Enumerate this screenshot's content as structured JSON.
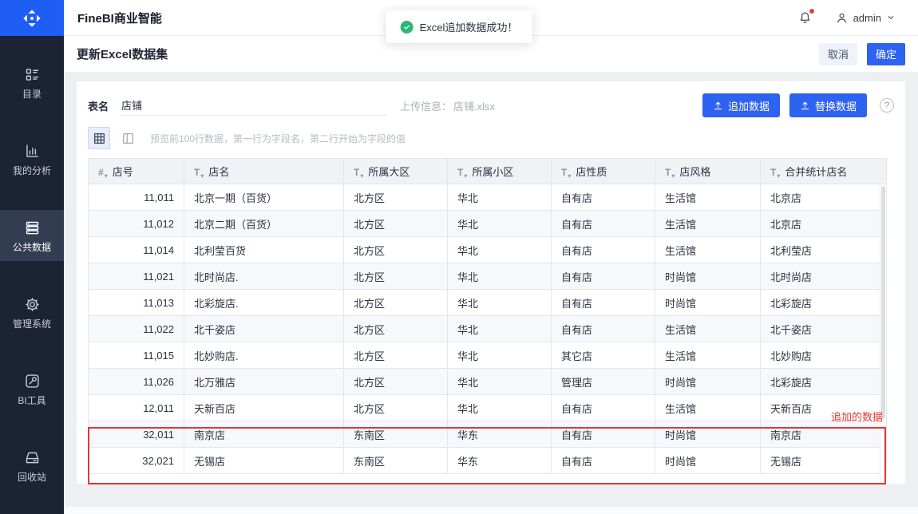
{
  "header": {
    "app_title": "FineBI商业智能",
    "user_name": "admin"
  },
  "toast": {
    "message": "Excel追加数据成功！"
  },
  "sidebar": {
    "logo_icon": "finebi-logo-icon",
    "items": [
      {
        "id": "directory",
        "label": "目录",
        "icon": "directory-icon",
        "active": false
      },
      {
        "id": "analysis",
        "label": "我的分析",
        "icon": "my-analysis-icon",
        "active": false
      },
      {
        "id": "public-data",
        "label": "公共数据",
        "icon": "public-data-icon",
        "active": true
      },
      {
        "id": "manage",
        "label": "管理系统",
        "icon": "gear-icon",
        "active": false
      },
      {
        "id": "tools",
        "label": "BI工具",
        "icon": "bi-tools-icon",
        "active": false
      },
      {
        "id": "recycle",
        "label": "回收站",
        "icon": "recycle-bin-icon",
        "active": false
      }
    ]
  },
  "page": {
    "title": "更新Excel数据集",
    "cancel_label": "取消",
    "confirm_label": "确定"
  },
  "form": {
    "table_name_label": "表名",
    "table_name_value": "店铺",
    "upload_info_label": "上传信息：",
    "upload_file_name": "店铺.xlsx",
    "append_button_label": "追加数据",
    "replace_button_label": "替换数据",
    "help_label": "?",
    "preview_hint": "预览前100行数据，第一行为字段名，第二行开始为字段的值"
  },
  "table": {
    "sort_glyph": "▾",
    "columns": [
      {
        "key": "store-no",
        "label": "店号",
        "type": "number",
        "type_icon": "#"
      },
      {
        "key": "store-name",
        "label": "店名",
        "type": "text",
        "type_icon": "T"
      },
      {
        "key": "region",
        "label": "所属大区",
        "type": "text",
        "type_icon": "T"
      },
      {
        "key": "district",
        "label": "所属小区",
        "type": "text",
        "type_icon": "T"
      },
      {
        "key": "store-type",
        "label": "店性质",
        "type": "text",
        "type_icon": "T"
      },
      {
        "key": "store-style",
        "label": "店风格",
        "type": "text",
        "type_icon": "T"
      },
      {
        "key": "merged-name",
        "label": "合并统计店名",
        "type": "text",
        "type_icon": "T"
      }
    ],
    "rows": [
      [
        "11,011",
        "北京一期（百货）",
        "北方区",
        "华北",
        "自有店",
        "生活馆",
        "北京店"
      ],
      [
        "11,012",
        "北京二期（百货）",
        "北方区",
        "华北",
        "自有店",
        "生活馆",
        "北京店"
      ],
      [
        "11,014",
        "北利莹百货",
        "北方区",
        "华北",
        "自有店",
        "生活馆",
        "北利莹店"
      ],
      [
        "11,021",
        "北时尚店.",
        "北方区",
        "华北",
        "自有店",
        "时尚馆",
        "北时尚店"
      ],
      [
        "11,013",
        "北彩旋店.",
        "北方区",
        "华北",
        "自有店",
        "时尚馆",
        "北彩旋店"
      ],
      [
        "11,022",
        "北千姿店",
        "北方区",
        "华北",
        "自有店",
        "生活馆",
        "北千姿店"
      ],
      [
        "11,015",
        "北妙购店.",
        "北方区",
        "华北",
        "其它店",
        "生活馆",
        "北妙购店"
      ],
      [
        "11,026",
        "北万雅店",
        "北方区",
        "华北",
        "管理店",
        "时尚馆",
        "北彩旋店"
      ],
      [
        "12,011",
        "天新百店",
        "北方区",
        "华北",
        "自有店",
        "生活馆",
        "天新百店"
      ],
      [
        "32,011",
        "南京店",
        "东南区",
        "华东",
        "自有店",
        "时尚馆",
        "南京店"
      ],
      [
        "32,021",
        "无锡店",
        "东南区",
        "华东",
        "自有店",
        "时尚馆",
        "无锡店"
      ]
    ],
    "appended_row_indexes": [
      9,
      10
    ]
  },
  "annotation": {
    "appended_label": "追加的数据",
    "color": "#e23734"
  },
  "colors": {
    "primary_blue": "#2e62f1",
    "sidebar_bg": "#1b2334",
    "sidebar_active_bg": "#333d52",
    "logo_bg": "#1e5ef5",
    "success_green": "#2bb876",
    "annotation_red": "#e23734",
    "table_header_bg": "#f0f2f5",
    "row_alt_bg": "#f6f8fb"
  }
}
